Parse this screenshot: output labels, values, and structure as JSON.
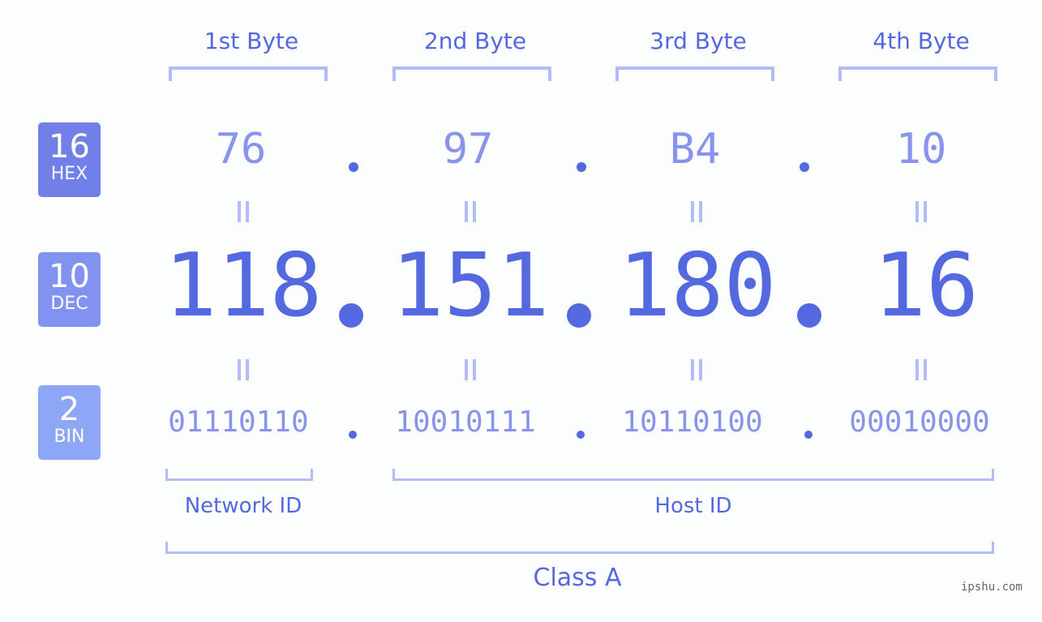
{
  "byte_labels": [
    "1st Byte",
    "2nd Byte",
    "3rd Byte",
    "4th Byte"
  ],
  "badges": {
    "hex": {
      "num": "16",
      "label": "HEX",
      "color": "#717fe8"
    },
    "dec": {
      "num": "10",
      "label": "DEC",
      "color": "#8292f0"
    },
    "bin": {
      "num": "2",
      "label": "BIN",
      "color": "#8da6f6"
    }
  },
  "hex": [
    "76",
    "97",
    "B4",
    "10"
  ],
  "dec": [
    "118",
    "151",
    "180",
    "16"
  ],
  "bin": [
    "01110110",
    "10010111",
    "10110100",
    "00010000"
  ],
  "network_label": "Network ID",
  "host_label": "Host ID",
  "class_label": "Class A",
  "watermark": "ipshu.com"
}
